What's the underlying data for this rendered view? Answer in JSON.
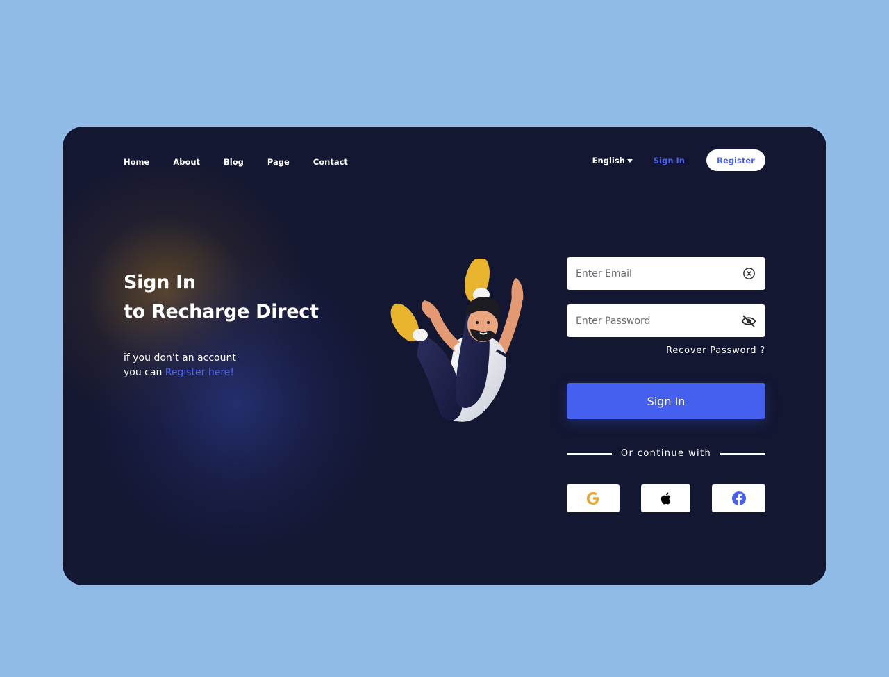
{
  "nav": {
    "items": [
      {
        "label": "Home"
      },
      {
        "label": "About"
      },
      {
        "label": "Blog"
      },
      {
        "label": "Page"
      },
      {
        "label": "Contact"
      }
    ]
  },
  "header": {
    "language": "English",
    "signin_label": "Sign In",
    "register_label": "Register"
  },
  "hero": {
    "title_line1": "Sign In",
    "title_line2": "to Recharge Direct",
    "subtitle_line1": "if you don’t an account",
    "subtitle_prefix": "you can ",
    "register_link": "Register here!"
  },
  "form": {
    "email_placeholder": "Enter Email",
    "password_placeholder": "Enter Password",
    "recover_label": "Recover Password ?",
    "submit_label": "Sign In",
    "divider_text": "Or continue with",
    "social": [
      {
        "icon": "google-icon"
      },
      {
        "icon": "apple-icon"
      },
      {
        "icon": "facebook-icon"
      }
    ]
  },
  "colors": {
    "page_bg": "#8fbbe6",
    "card_bg": "#141732",
    "accent": "#4560ef",
    "google": "#e6a830",
    "facebook": "#4a62f0"
  }
}
